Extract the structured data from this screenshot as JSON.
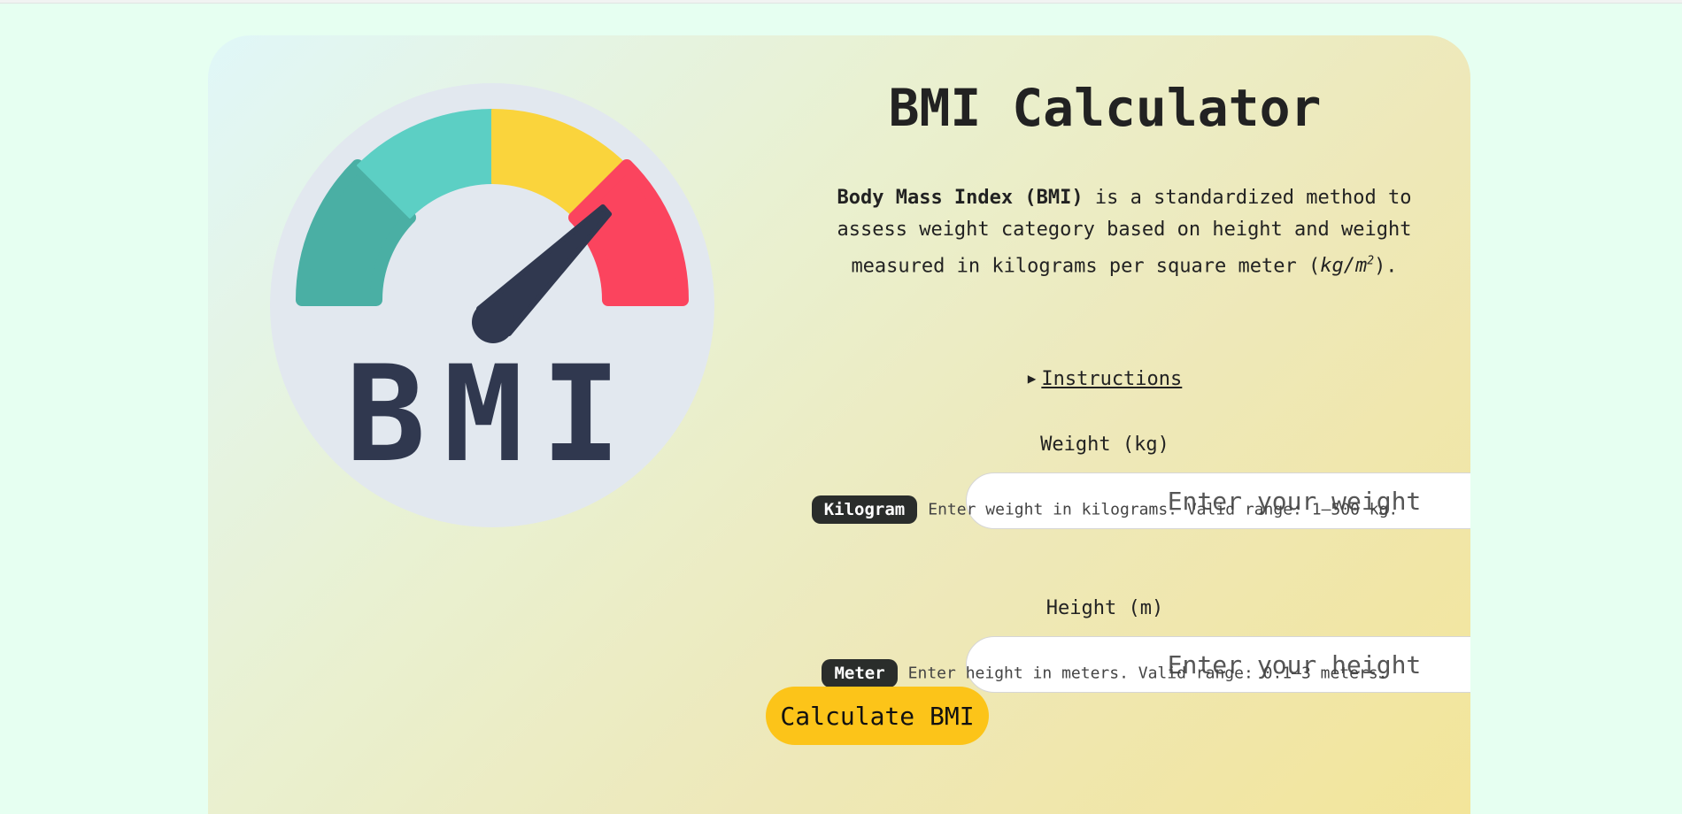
{
  "header": {
    "title": "BMI Calculator"
  },
  "logo": {
    "text": "BMI",
    "colors": {
      "background": "#e2e8ef",
      "segment_green": "#4aafa4",
      "segment_teal": "#5ccfc4",
      "segment_yellow": "#fad43c",
      "segment_red": "#fb445e",
      "needle": "#30384f"
    }
  },
  "description": {
    "bold": "Body Mass Index (BMI)",
    "text": " is a standardized method to assess weight category based on height and weight measured in kilograms per square meter (",
    "unit": "kg/m",
    "unit_sup": "2",
    "end": ")."
  },
  "instructions": {
    "icon": "triangle-right-icon",
    "label": "Instructions"
  },
  "weight": {
    "label": "Weight (kg)",
    "placeholder": "Enter your weight",
    "value": "",
    "badge": "Kilogram",
    "help": "Enter weight in kilograms. Valid range: 1–500 kg."
  },
  "height": {
    "label": "Height (m)",
    "placeholder": "Enter your height",
    "value": "",
    "badge": "Meter",
    "help": "Enter height in meters. Valid range: 0.1–3 meters."
  },
  "actions": {
    "calculate_label": "Calculate BMI",
    "accent": "#fcc419"
  }
}
